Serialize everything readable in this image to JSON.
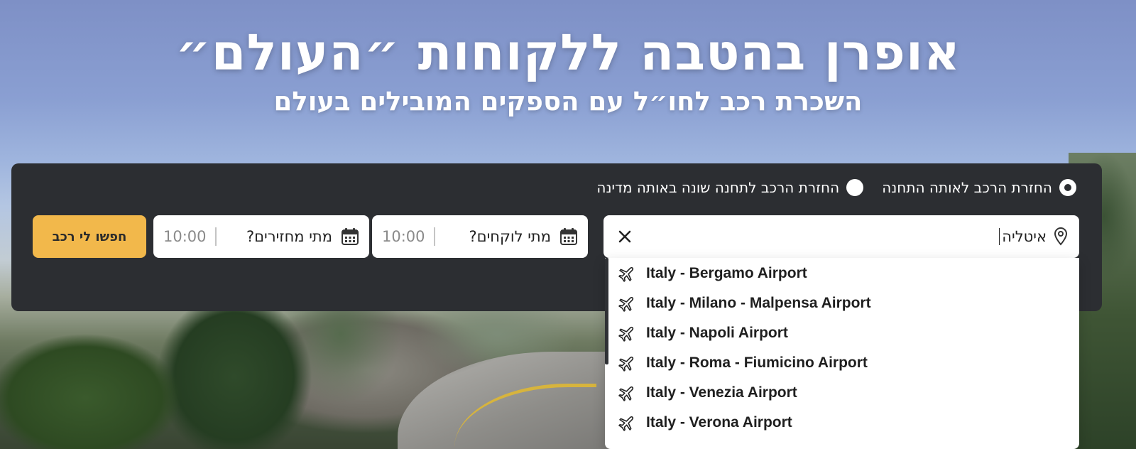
{
  "hero": {
    "title": "אופרן בהטבה ללקוחות ״העולם״",
    "subtitle": "השכרת רכב לחו״ל עם הספקים המובילים בעולם"
  },
  "search_form": {
    "radio_options": [
      {
        "label": "החזרת הרכב לאותה התחנה",
        "selected": true
      },
      {
        "label": "החזרת הרכב לתחנה שונה באותה מדינה",
        "selected": false
      }
    ],
    "location": {
      "value": "איטליה",
      "icon": "location-pin-icon",
      "clear_icon": "close-icon"
    },
    "pickup": {
      "label": "מתי לוקחים?",
      "time": "10:00",
      "icon": "calendar-icon"
    },
    "return": {
      "label": "מתי מחזירים?",
      "time": "10:00",
      "icon": "calendar-icon"
    },
    "search_button": "חפשו לי רכב",
    "accent_color": "#f2b84b",
    "panel_color": "#2c2e32"
  },
  "suggestions": [
    {
      "label": "Italy - Bergamo Airport",
      "icon": "airplane-icon"
    },
    {
      "label": "Italy - Milano - Malpensa Airport",
      "icon": "airplane-icon"
    },
    {
      "label": "Italy - Napoli Airport",
      "icon": "airplane-icon"
    },
    {
      "label": "Italy - Roma - Fiumicino Airport",
      "icon": "airplane-icon"
    },
    {
      "label": "Italy - Venezia Airport",
      "icon": "airplane-icon"
    },
    {
      "label": "Italy - Verona Airport",
      "icon": "airplane-icon"
    }
  ]
}
